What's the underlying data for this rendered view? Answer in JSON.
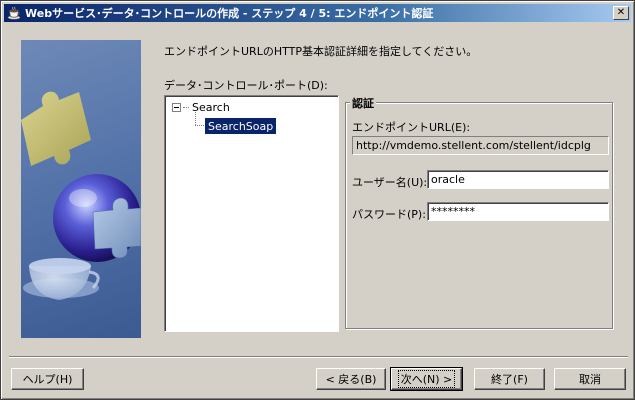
{
  "window": {
    "title": "Webサービス･データ･コントロールの作成 - ステップ 4 / 5: エンドポイント認証",
    "close_glyph": "✕"
  },
  "main": {
    "instruction": "エンドポイントURLのHTTP基本認証詳細を指定してください。",
    "ports_label": "データ･コントロール･ポート(D):"
  },
  "tree": {
    "root": "Search",
    "child": "SearchSoap"
  },
  "auth": {
    "group_title": "認証",
    "endpoint_label": "エンドポイントURL(E):",
    "endpoint_value": "http://vmdemo.stellent.com/stellent/idcplg",
    "username_label": "ユーザー名(U):",
    "username_value": "oracle",
    "password_label": "パスワード(P):",
    "password_value": "********"
  },
  "buttons": {
    "help": "ヘルプ(H)",
    "back": "< 戻る(B)",
    "next": "次へ(N) >",
    "finish": "終了(F)",
    "cancel": "取消"
  },
  "icons": {
    "title_icon": "coffee-cup-icon",
    "tree_expander": "collapse-minus-icon"
  }
}
